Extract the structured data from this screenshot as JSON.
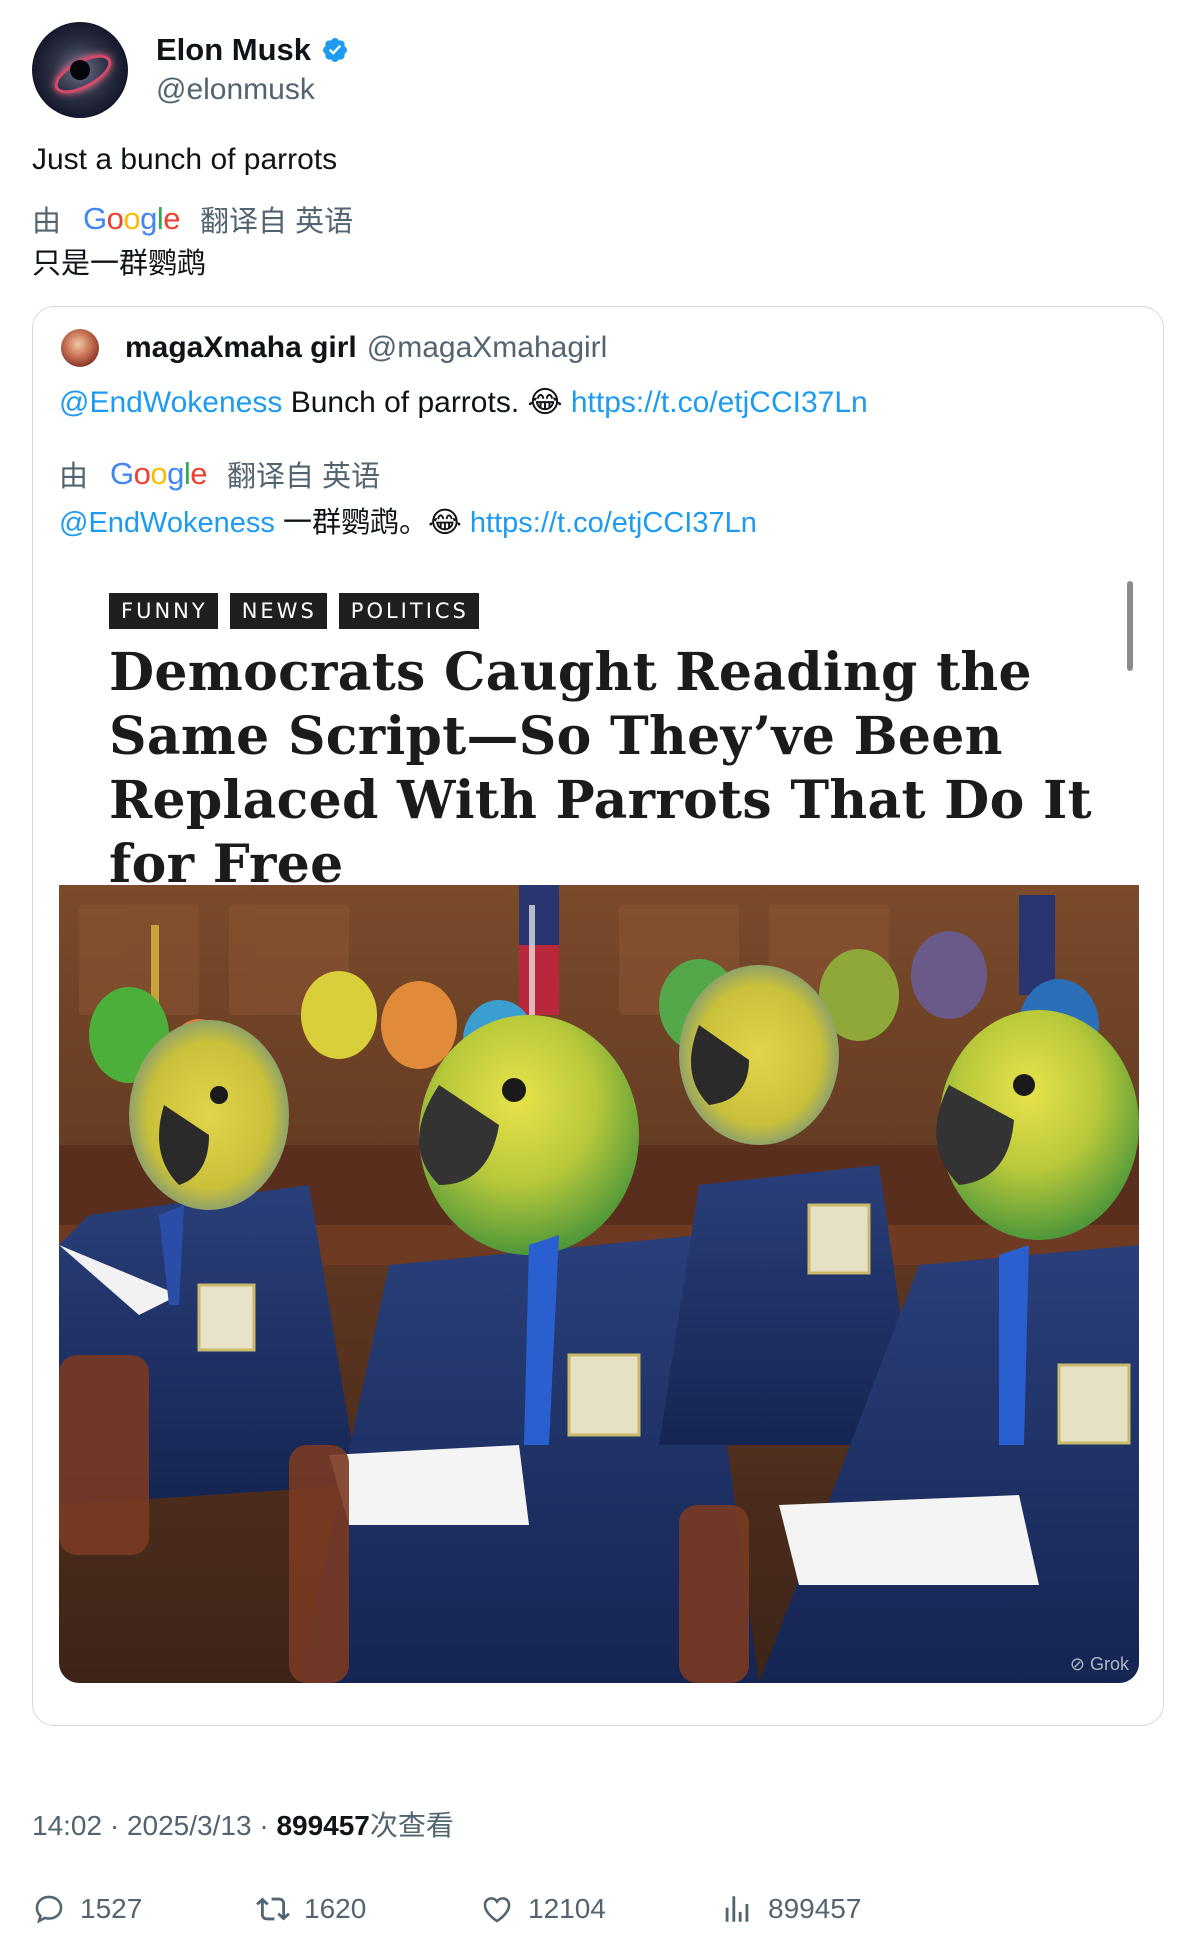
{
  "author": {
    "display_name": "Elon Musk",
    "handle": "@elonmusk"
  },
  "tweet": {
    "text": "Just a bunch of parrots",
    "translation_prefix": "由",
    "translation_suffix": "翻译自 英语",
    "google_letters": [
      "G",
      "o",
      "o",
      "g",
      "l",
      "e"
    ],
    "translated_text": "只是一群鹦鹉"
  },
  "quote": {
    "display_name": "magaXmaha girl",
    "handle": "@magaXmahagirl",
    "mention": "@EndWokeness",
    "text": " Bunch of parrots. 😂 ",
    "link": "https://t.co/etjCCI37Ln",
    "translation_prefix": "由",
    "translation_suffix": "翻译自 英语",
    "translated_mention": "@EndWokeness",
    "translated_text": " 一群鹦鹉。😂 ",
    "translated_link": "https://t.co/etjCCI37Ln",
    "media": {
      "tags": [
        "FUNNY",
        "NEWS",
        "POLITICS"
      ],
      "headline": "Democrats Caught Reading the Same Script—So They’ve Been Replaced With Parrots That Do It for Free",
      "watermark": "Grok"
    }
  },
  "meta": {
    "time": "14:02",
    "separator": " · ",
    "date": "2025/3/13",
    "views": "899457",
    "views_label": "次查看"
  },
  "actions": {
    "replies": "1527",
    "reposts": "1620",
    "likes": "12104",
    "views": "899457"
  },
  "colors": {
    "link": "#1d9bf0",
    "secondary_text": "#536471",
    "verified": "#1d9bf0"
  }
}
